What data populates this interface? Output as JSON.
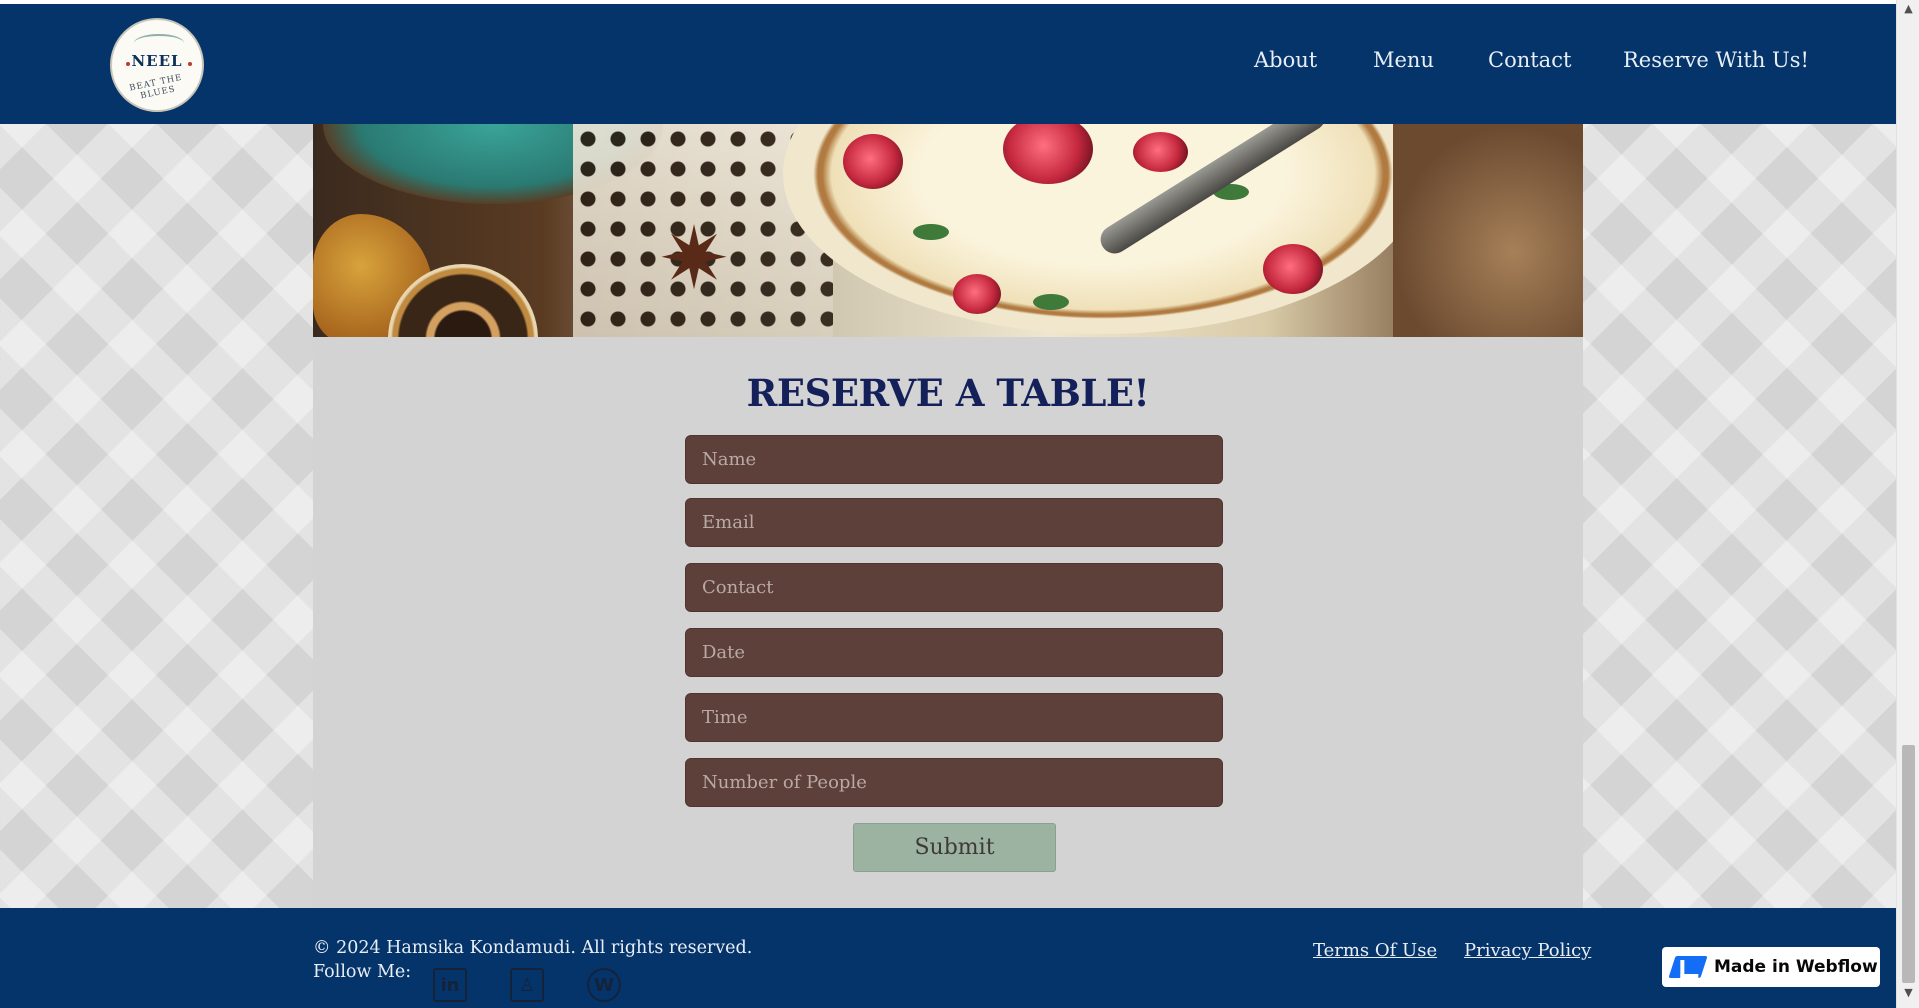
{
  "header": {
    "logo": {
      "name": "NEEL",
      "tagline": "BEAT THE BLUES"
    },
    "nav": [
      {
        "label": "About"
      },
      {
        "label": "Menu"
      },
      {
        "label": "Contact"
      },
      {
        "label": "Reserve With Us!"
      }
    ]
  },
  "form": {
    "title": "RESERVE A TABLE!",
    "fields": [
      {
        "placeholder": "Name",
        "value": ""
      },
      {
        "placeholder": "Email",
        "value": ""
      },
      {
        "placeholder": "Contact",
        "value": ""
      },
      {
        "placeholder": "Date",
        "value": ""
      },
      {
        "placeholder": "Time",
        "value": ""
      },
      {
        "placeholder": "Number of People",
        "value": ""
      }
    ],
    "submit_label": "Submit"
  },
  "footer": {
    "copyright": "© 2024 Hamsika Kondamudi. All rights reserved.",
    "follow_label": "Follow Me:",
    "social": [
      {
        "icon": "linkedin-icon",
        "glyph": "in"
      },
      {
        "icon": "github-icon",
        "glyph": "♙"
      },
      {
        "icon": "wordpress-icon",
        "glyph": "W"
      }
    ],
    "links": [
      {
        "label": "Terms Of Use"
      },
      {
        "label": "Privacy Policy"
      }
    ],
    "badge_label": "Made in Webflow"
  },
  "colors": {
    "nav_bg": "#05346a",
    "title": "#14205a",
    "field_bg": "#5e403a",
    "submit_bg": "#9db3a2",
    "page_bg": "#d4d4d4",
    "webflow_blue": "#146ef5"
  }
}
